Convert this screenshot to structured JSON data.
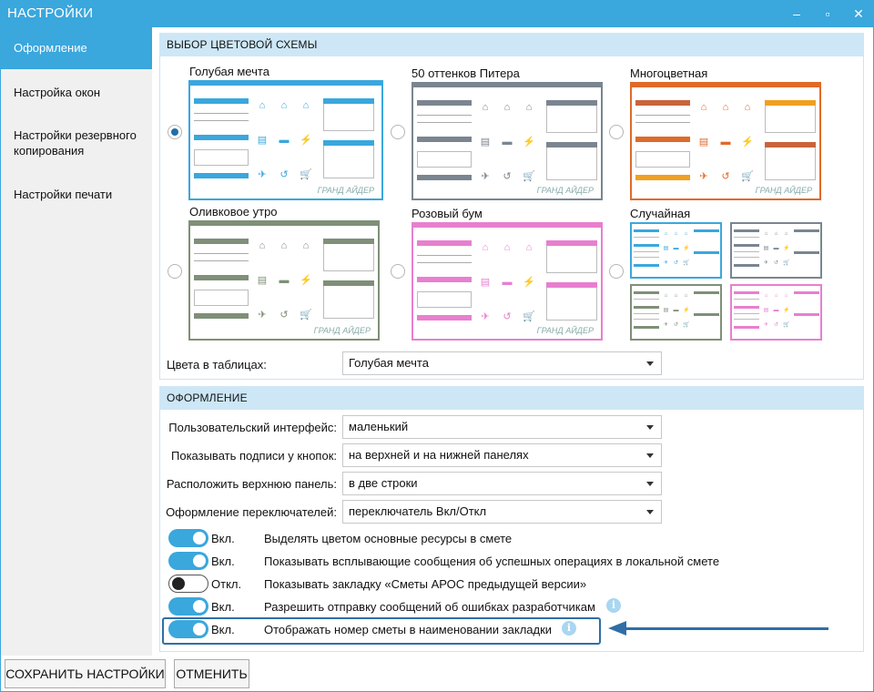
{
  "window": {
    "title": "НАСТРОЙКИ",
    "minimize": "–",
    "maximize": "▫",
    "close": "✕"
  },
  "sidebar": {
    "items": [
      {
        "label": "Оформление",
        "active": true
      },
      {
        "label": "Настройка окон",
        "active": false
      },
      {
        "label": "Настройки резервного копирования",
        "active": false
      },
      {
        "label": "Настройки печати",
        "active": false
      }
    ]
  },
  "color_scheme": {
    "header": "ВЫБОР ЦВЕТОВОЙ СХЕМЫ",
    "schemes": [
      {
        "name": "Голубая мечта",
        "selected": true,
        "color": "#3aa7dd"
      },
      {
        "name": "50 оттенков Питера",
        "selected": false,
        "color": "#7a8590"
      },
      {
        "name": "Многоцветная",
        "selected": false,
        "color": "#e06a2a"
      },
      {
        "name": "Оливковое утро",
        "selected": false,
        "color": "#7f8f78"
      },
      {
        "name": "Розовый бум",
        "selected": false,
        "color": "#e87fcf"
      },
      {
        "name": "Случайная",
        "selected": false,
        "color": "#3aa7dd"
      }
    ],
    "brand_text": "ГРАНД АЙДЕР",
    "table_colors_label": "Цвета в таблицах:",
    "table_colors_value": "Голубая мечта"
  },
  "appearance": {
    "header": "ОФОРМЛЕНИЕ",
    "fields": [
      {
        "label": "Пользовательский интерфейс:",
        "value": "маленький"
      },
      {
        "label": "Показывать подписи у кнопок:",
        "value": "на верхней и на нижней панелях"
      },
      {
        "label": "Расположить верхнюю панель:",
        "value": "в две строки"
      },
      {
        "label": "Оформление переключателей:",
        "value": "переключатель Вкл/Откл"
      }
    ],
    "toggles": [
      {
        "on": true,
        "state": "Вкл.",
        "text": "Выделять цветом основные ресурсы в смете",
        "info": false
      },
      {
        "on": true,
        "state": "Вкл.",
        "text": "Показывать всплывающие сообщения об успешных операциях в локальной смете",
        "info": false
      },
      {
        "on": false,
        "state": "Откл.",
        "text": "Показывать закладку «Сметы АРОС предыдущей версии»",
        "info": false
      },
      {
        "on": true,
        "state": "Вкл.",
        "text": "Разрешить отправку сообщений об ошибках разработчикам",
        "info": true
      },
      {
        "on": true,
        "state": "Вкл.",
        "text": "Отображать номер сметы в наименовании закладки",
        "info": true
      }
    ],
    "info_glyph": "i"
  },
  "footer": {
    "save": "СОХРАНИТЬ НАСТРОЙКИ",
    "cancel": "ОТМЕНИТЬ"
  },
  "colors": {
    "accent": "#3aa7dd",
    "header_bg": "#cde7f7",
    "annotation": "#2f6fa6"
  }
}
